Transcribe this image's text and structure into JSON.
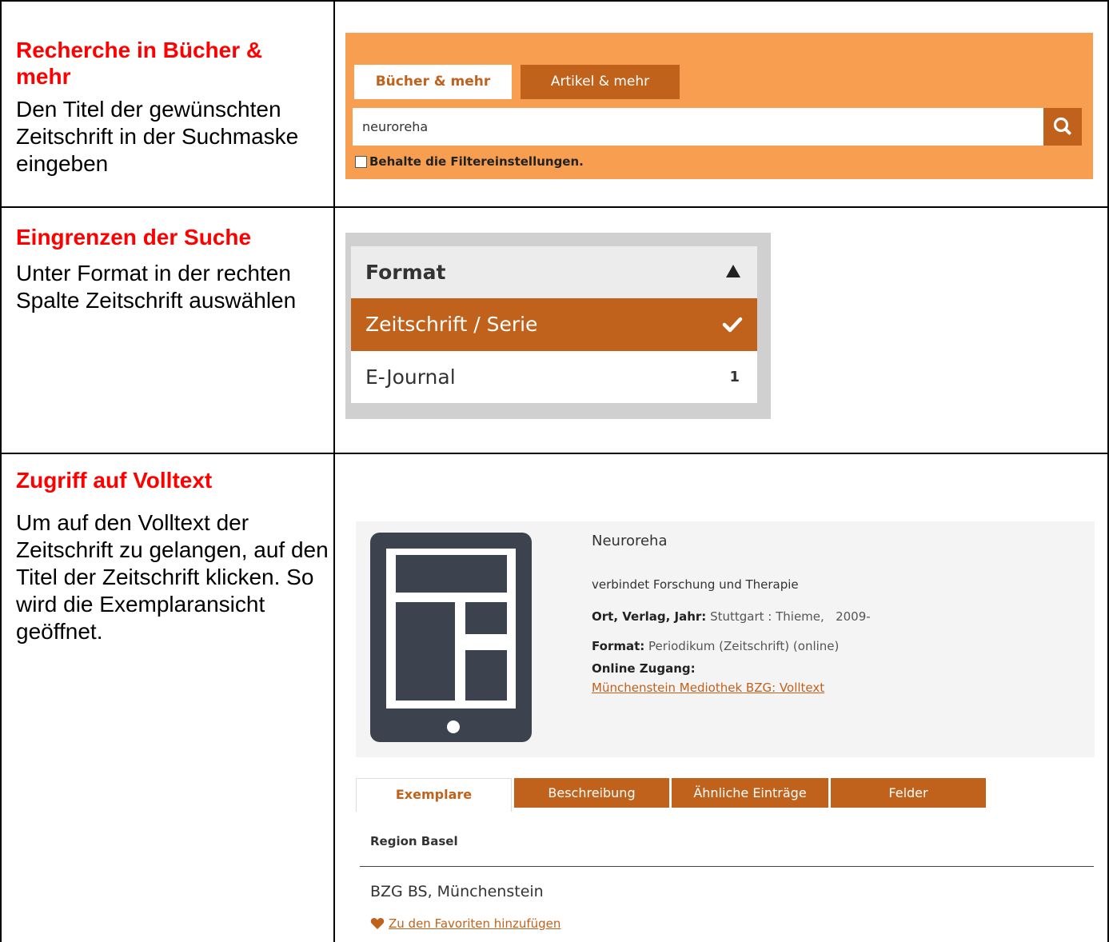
{
  "rows": [
    {
      "heading": "Recherche in Bücher &\n mehr",
      "description": "Den Titel der gewünschten Zeitschrift in der Suchmaske eingeben"
    },
    {
      "heading": "Eingrenzen der Suche",
      "description": "Unter Format in der rechten Spalte Zeitschrift auswählen"
    },
    {
      "heading": "Zugriff auf Volltext",
      "description": "Um auf den Volltext der Zeitschrift zu gelangen, auf den Titel der Zeitschrift klicken. So wird die Exemplaransicht geöffnet."
    }
  ],
  "search": {
    "tabs": [
      "Bücher & mehr",
      "Artikel & mehr"
    ],
    "active_tab": "Bücher & mehr",
    "query": "neuroreha",
    "search_icon": "search-icon",
    "keep_filters_label": "Behalte die Filtereinstellungen.",
    "keep_filters_checked": false,
    "panel_color": "#f79e50",
    "accent_color": "#c0621b"
  },
  "facet": {
    "title": "Format",
    "caret_icon": "triangle-up-icon",
    "selected_label": "Zeitschrift / Serie",
    "check_icon": "check-icon",
    "item_label": "E-Journal",
    "item_count": "1"
  },
  "record": {
    "icon": "tablet-icon",
    "title": "Neuroreha",
    "subtitle": "verbindet Forschung und Therapie",
    "publisher_label": "Ort, Verlag, Jahr:",
    "publisher_value": "Stuttgart : Thieme,   2009-",
    "format_label": "Format:",
    "format_value": "Periodikum (Zeitschrift) (online)",
    "online_label": "Online Zugang:",
    "online_link": "Münchenstein Mediothek BZG: Volltext",
    "tabs": [
      "Exemplare",
      "Beschreibung",
      "Ähnliche Einträge",
      "Felder"
    ],
    "active_tab": "Exemplare",
    "region": "Region Basel",
    "location": "BZG BS, Münchenstein",
    "favorite_icon": "heart-icon",
    "favorite_link": "Zu den Favoriten hinzufügen"
  }
}
